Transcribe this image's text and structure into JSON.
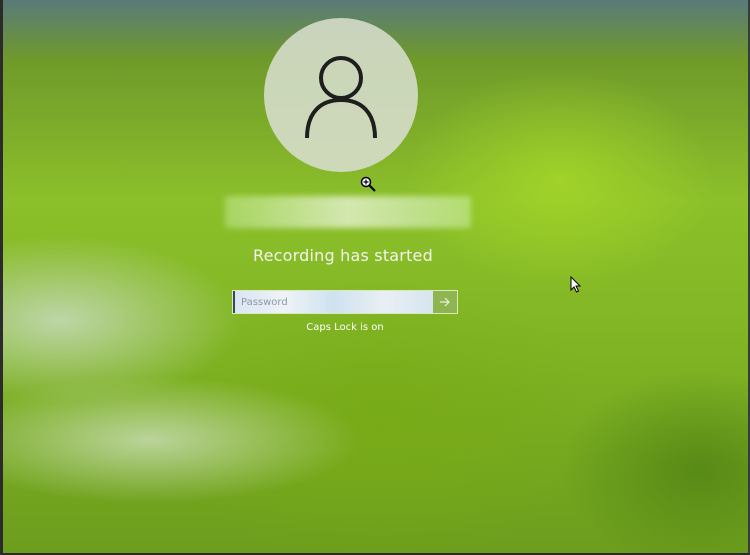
{
  "lock_screen": {
    "avatar_icon": "user-silhouette-icon",
    "status_message": "Recording has started",
    "password": {
      "placeholder": "Password",
      "value": "",
      "submit_icon": "arrow-right-icon"
    },
    "caps_lock_message": "Caps Lock is on"
  },
  "cursors": {
    "magnifier_icon": "magnifier-cursor-icon",
    "pointer_icon": "arrow-pointer-icon"
  },
  "colors": {
    "text": "#f2f6ec",
    "avatar_bg": "#d7decd",
    "accent_green": "#8cc02a"
  }
}
